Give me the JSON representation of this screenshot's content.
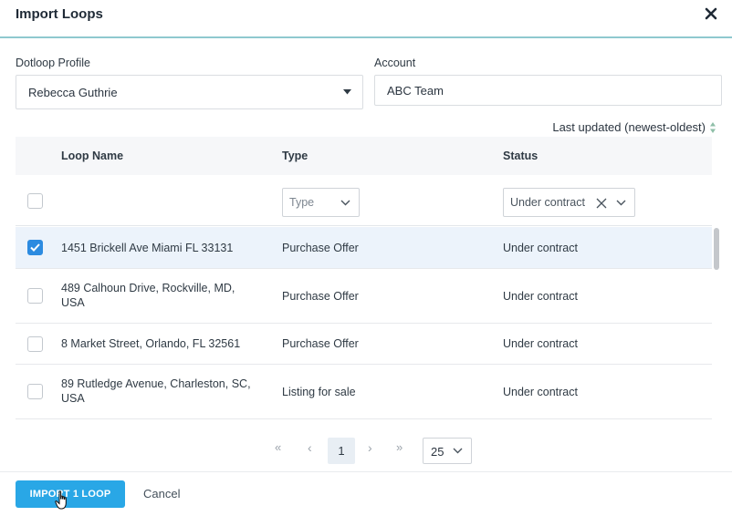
{
  "dialog": {
    "title": "Import Loops",
    "close_icon": "close-icon"
  },
  "form": {
    "profile_label": "Dotloop Profile",
    "profile_value": "Rebecca Guthrie",
    "account_label": "Account",
    "account_value": "ABC Team"
  },
  "sort": {
    "label": "Last updated (newest-oldest)"
  },
  "table": {
    "headers": {
      "loop_name": "Loop Name",
      "type": "Type",
      "status": "Status"
    },
    "filters": {
      "type_placeholder": "Type",
      "status_value": "Under contract"
    },
    "rows": [
      {
        "name_line1": "1451 Brickell Ave Miami FL 33131",
        "name_line2": "",
        "type": "Purchase Offer",
        "status": "Under contract",
        "checked": true
      },
      {
        "name_line1": "489 Calhoun Drive, Rockville, MD,",
        "name_line2": "USA",
        "type": "Purchase Offer",
        "status": "Under contract",
        "checked": false
      },
      {
        "name_line1": "8 Market Street, Orlando, FL 32561",
        "name_line2": "",
        "type": "Purchase Offer",
        "status": "Under contract",
        "checked": false
      },
      {
        "name_line1": "89 Rutledge Avenue, Charleston, SC,",
        "name_line2": "USA",
        "type": "Listing for sale",
        "status": "Under contract",
        "checked": false
      }
    ]
  },
  "pagination": {
    "first": "«",
    "prev": "‹",
    "current_page": "1",
    "next": "›",
    "last": "»",
    "page_size": "25"
  },
  "footer": {
    "import_label": "IMPORT 1 LOOP",
    "cancel_label": "Cancel"
  },
  "colors": {
    "accent": "#29a7e6",
    "checkbox_checked": "#2c8be0",
    "selected_row": "#ecf3fb",
    "header_divider": "#8fc9cf"
  }
}
